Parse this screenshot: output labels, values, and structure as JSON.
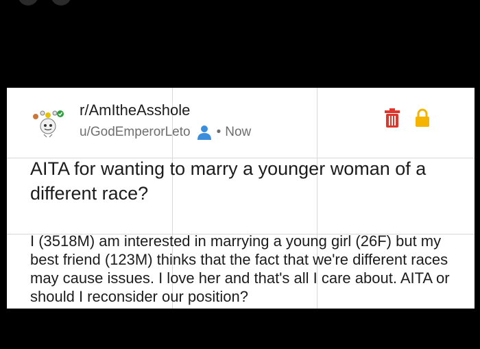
{
  "post": {
    "subreddit": "r/AmItheAsshole",
    "author": "u/GodEmperorLeto",
    "separator": "•",
    "time": "Now",
    "title": "AITA for wanting to marry a younger woman of a different race?",
    "body": "I (3518M) am interested in marrying a young girl (26F) but my best friend (123M)  thinks that the fact that we're different races may cause issues. I love her and that's all I care about. AITA or should I reconsider our position?"
  },
  "icons": {
    "avatar": "snoo-avatar-icon",
    "user": "user-icon",
    "trash": "trash-icon",
    "lock": "lock-icon"
  },
  "colors": {
    "background": "#000000",
    "card": "#ffffff",
    "trash": "#e0352b",
    "lock": "#f4b400",
    "user_icon": "#3a8edb",
    "text": "#1c1c1c",
    "meta_text": "#6e6e6e"
  }
}
